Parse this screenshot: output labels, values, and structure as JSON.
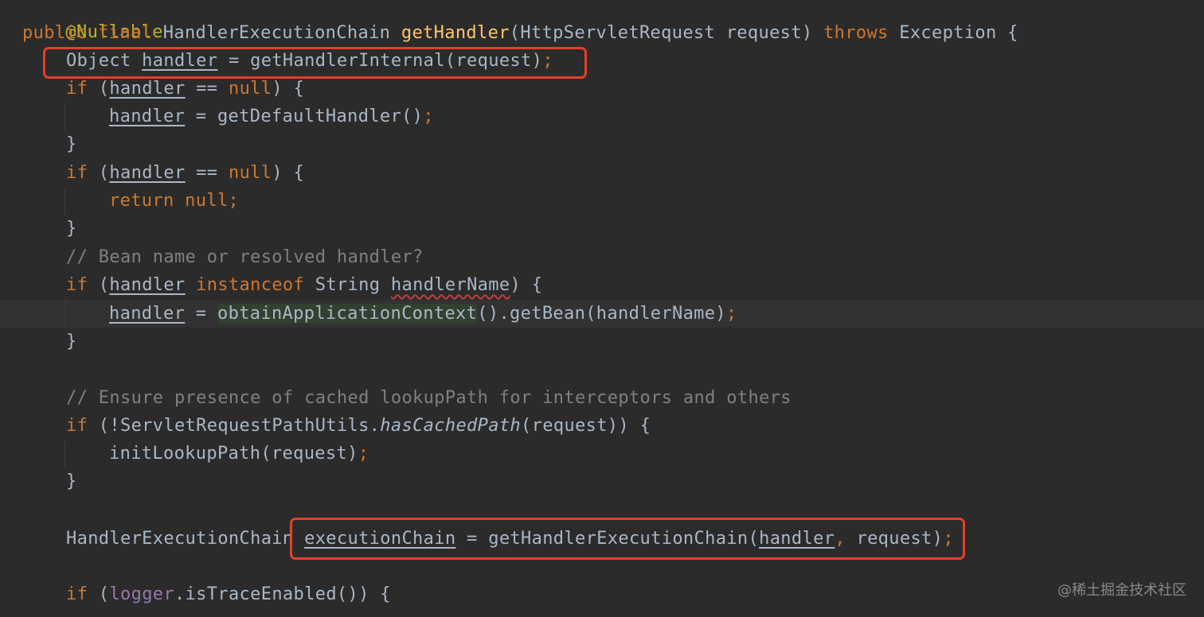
{
  "code": {
    "l0": "@Nullable",
    "l1": {
      "a": "public final ",
      "b": "HandlerExecutionChain ",
      "c": "getHandler",
      "d": "(HttpServletRequest request) ",
      "e": "throws ",
      "f": "Exception {"
    },
    "l2": {
      "a": "Object ",
      "b": "handler",
      "c": " = getHandlerInternal(request)",
      "d": ";"
    },
    "l3": {
      "a": "if ",
      "b": "(",
      "c": "handler",
      "d": " == ",
      "e": "null",
      "f": ") {"
    },
    "l4": {
      "a": "handler",
      "b": " = getDefaultHandler()",
      "c": ";"
    },
    "l5": "}",
    "l6": {
      "a": "if ",
      "b": "(",
      "c": "handler",
      "d": " == ",
      "e": "null",
      "f": ") {"
    },
    "l7": {
      "a": "return null",
      "b": ";"
    },
    "l8": "}",
    "l9": "// Bean name or resolved handler?",
    "l10": {
      "a": "if ",
      "b": "(",
      "c": "handler",
      "d": " instanceof ",
      "e": "String ",
      "f": "handlerName",
      "g": ") {"
    },
    "l11": {
      "a": "handler",
      "b": " = ",
      "c": "obtainApplicationContext",
      "d": "().getBean(handlerName)",
      "e": ";"
    },
    "l12": "}",
    "l14": "// Ensure presence of cached lookupPath for interceptors and others",
    "l15": {
      "a": "if ",
      "b": "(!ServletRequestPathUtils.",
      "c": "hasCachedPath",
      "d": "(request)) {"
    },
    "l16": {
      "a": "initLookupPath(request)",
      "b": ";"
    },
    "l17": "}",
    "l19": {
      "a": "HandlerExecutionChain ",
      "b": "executionChain",
      "c": " = getHandlerExecutionChain(",
      "d": "handler",
      "e": ", ",
      "f": "request)",
      "g": ";"
    },
    "l21": {
      "a": "if ",
      "b": "(",
      "c": "logger",
      "d": ".isTraceEnabled()) {"
    }
  },
  "watermark": "@稀土掘金技术社区",
  "colors": {
    "background": "#2b2b2b",
    "keyword": "#cc7832",
    "annotation": "#bbb529",
    "method": "#ffc66d",
    "comment": "#808080",
    "field": "#9876aa",
    "highlight_box": "#e2402b"
  }
}
